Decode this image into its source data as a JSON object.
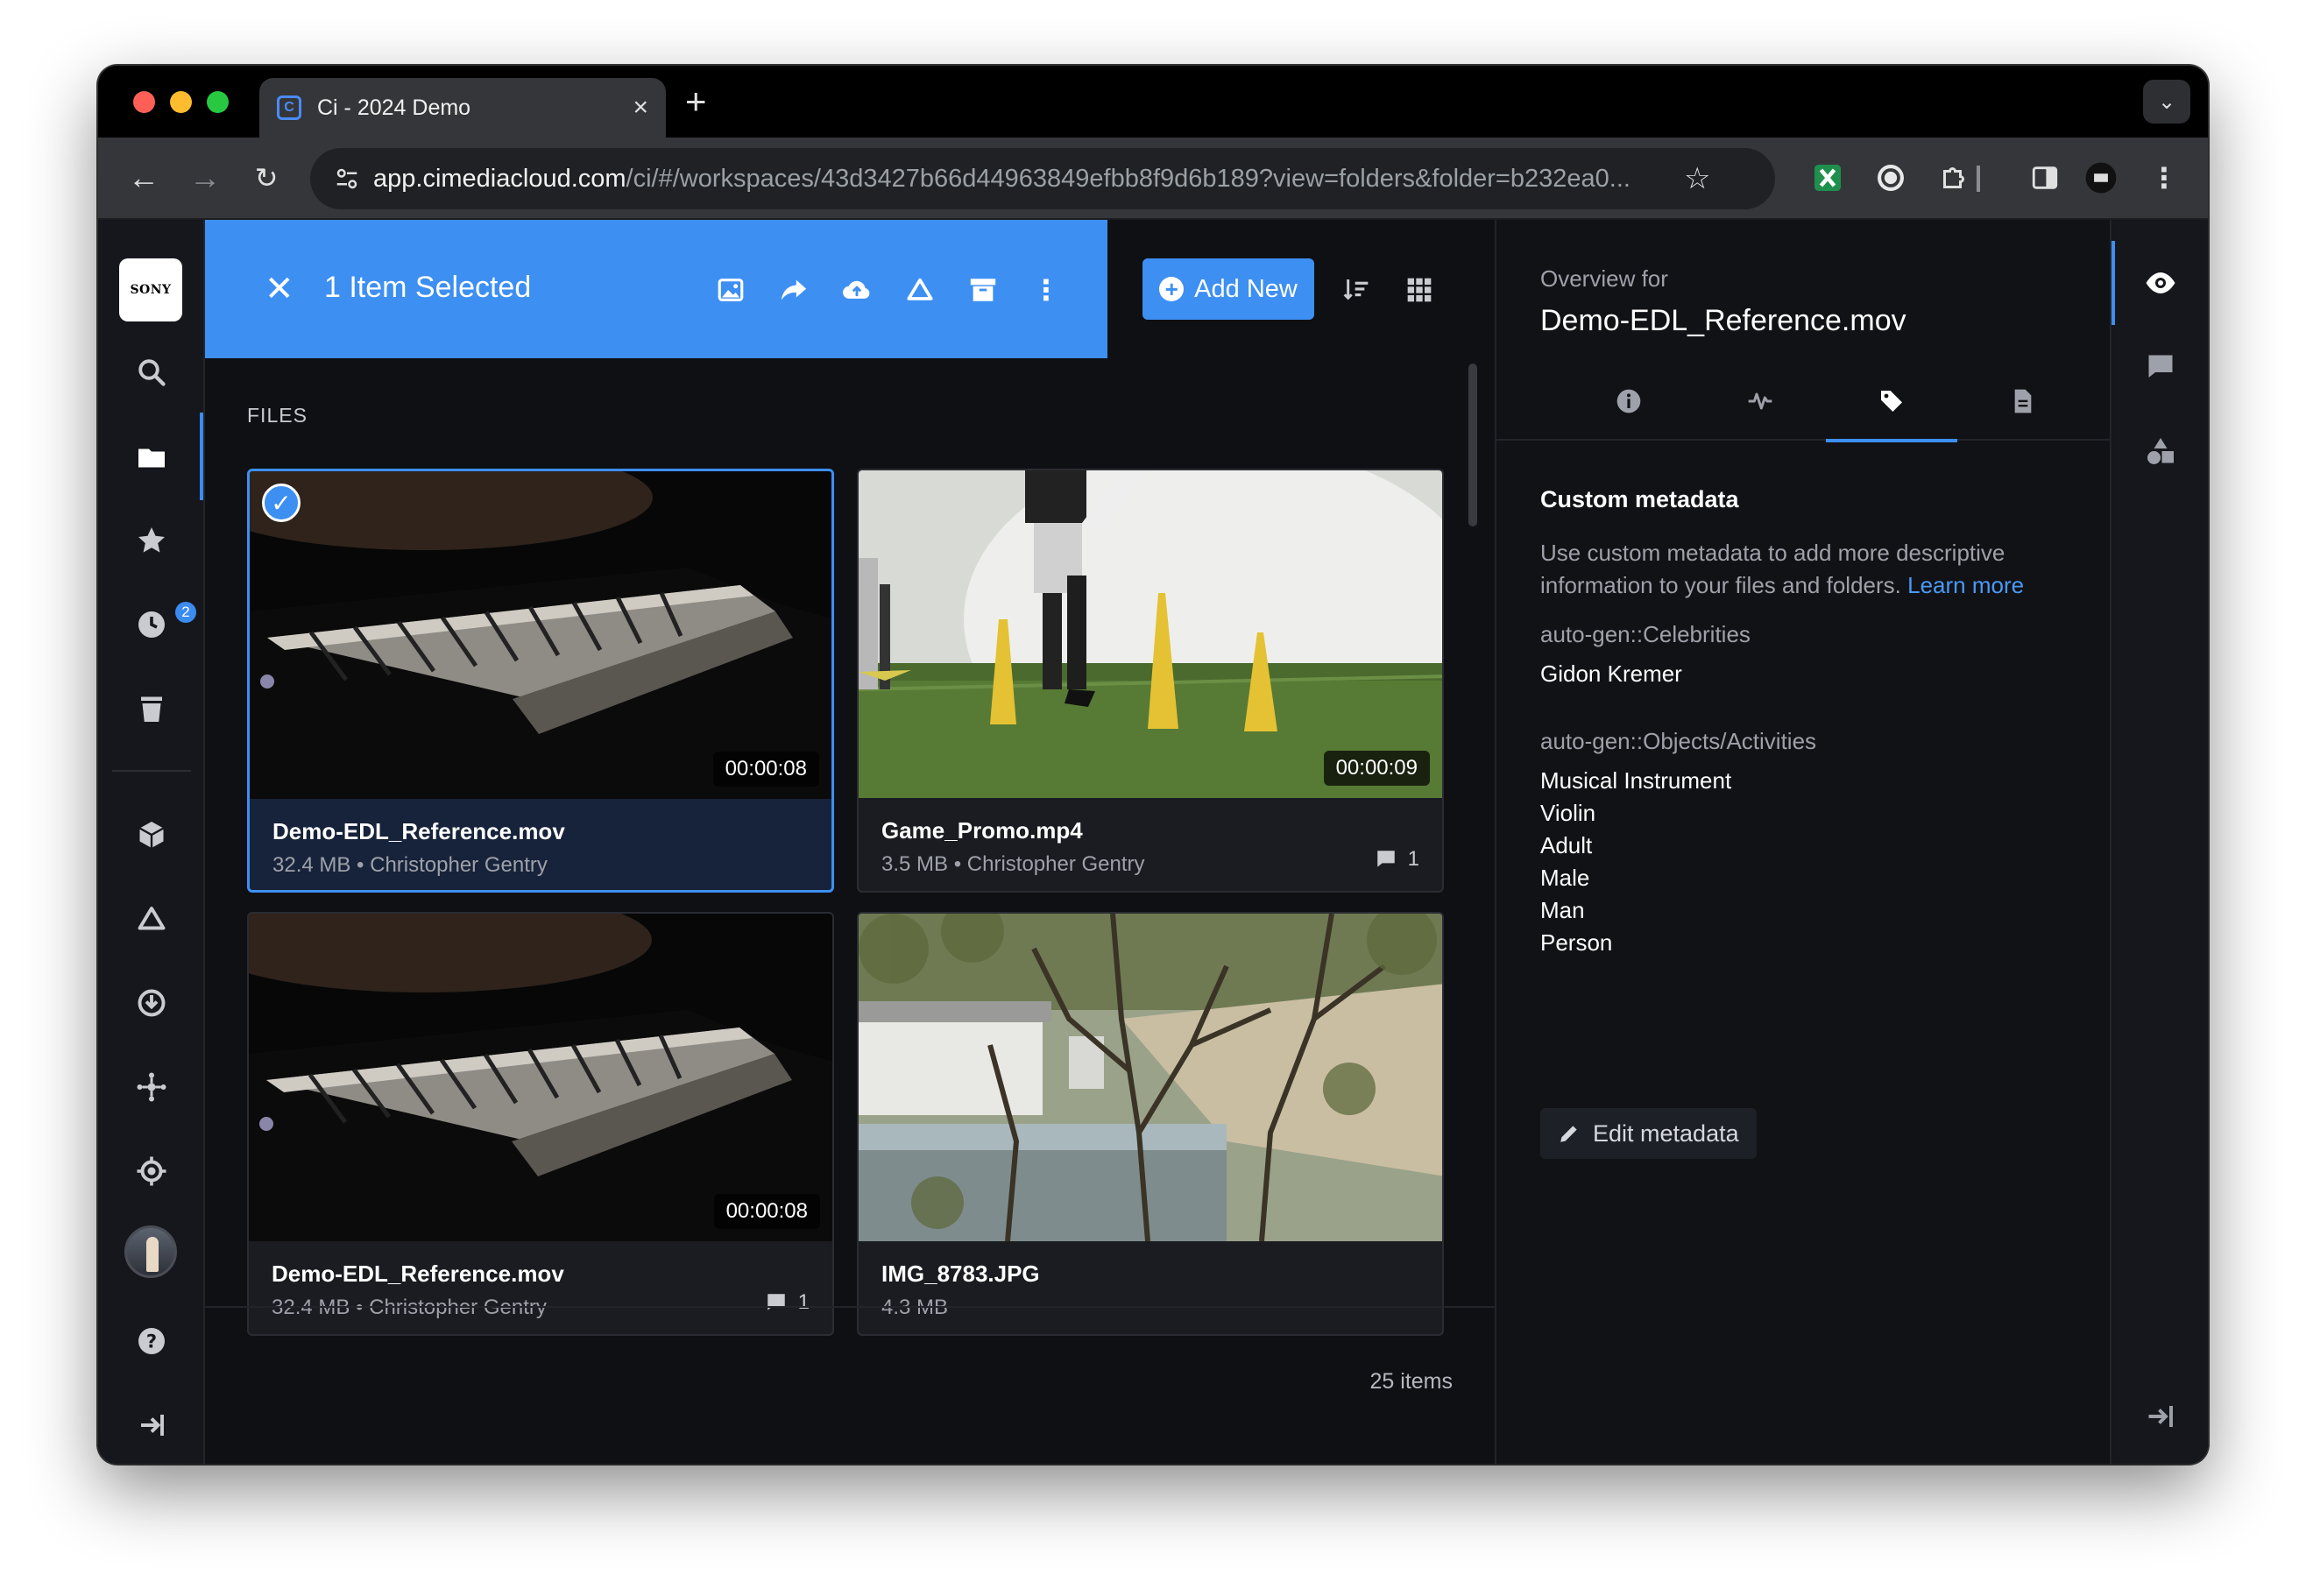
{
  "browser": {
    "tab_title": "Ci - 2024 Demo",
    "url_host": "app.cimediacloud.com",
    "url_path": "/ci/#/workspaces/43d3427b66d44963849efbb8f9d6b189?view=folders&folder=b232ea0..."
  },
  "sidebar": {
    "logo_text": "SONY",
    "recent_badge": "2",
    "items": [
      "search-icon",
      "folder-icon",
      "star-icon",
      "clock-icon",
      "trash-icon",
      "cube-icon",
      "cloud-icon",
      "download-icon",
      "network-icon",
      "target-icon",
      "avatar",
      "help-icon",
      "logout-icon"
    ]
  },
  "selection_bar": {
    "title": "1 Item Selected",
    "actions": [
      "image-icon",
      "share-icon",
      "cloud-upload-icon",
      "cloud-outline-icon",
      "archive-icon",
      "more-icon"
    ]
  },
  "toolbar": {
    "add_new_label": "Add New"
  },
  "files": {
    "section_label": "FILES",
    "cards": [
      {
        "name": "Demo-EDL_Reference.mov",
        "meta": "32.4 MB • Christopher Gentry",
        "duration": "00:00:08",
        "comments": "",
        "selected": true
      },
      {
        "name": "Game_Promo.mp4",
        "meta": "3.5 MB • Christopher Gentry",
        "duration": "00:00:09",
        "comments": "1",
        "selected": false
      },
      {
        "name": "Demo-EDL_Reference.mov",
        "meta": "32.4 MB • Christopher Gentry",
        "duration": "00:00:08",
        "comments": "1",
        "selected": false
      },
      {
        "name": "IMG_8783.JPG",
        "meta": "4.3 MB",
        "duration": "",
        "comments": "",
        "selected": false
      }
    ],
    "items_count": "25 items"
  },
  "panel": {
    "overview_label": "Overview for",
    "file_name": "Demo-EDL_Reference.mov",
    "tabs": [
      "info-icon",
      "activity-icon",
      "tag-icon",
      "document-icon"
    ],
    "active_tab": "tag-icon",
    "custom_title": "Custom metadata",
    "custom_desc": "Use custom metadata to add more descriptive information to your files and folders.",
    "learn_more": "Learn more",
    "groups": [
      {
        "key": "auto-gen::Celebrities",
        "values": [
          "Gidon Kremer"
        ]
      },
      {
        "key": "auto-gen::Objects/Activities",
        "values": [
          "Musical Instrument",
          "Violin",
          "Adult",
          "Male",
          "Man",
          "Person"
        ]
      }
    ],
    "edit_label": "Edit metadata"
  },
  "colors": {
    "accent": "#3d8ff2",
    "background": "#0f1014",
    "panel": "#111216"
  }
}
